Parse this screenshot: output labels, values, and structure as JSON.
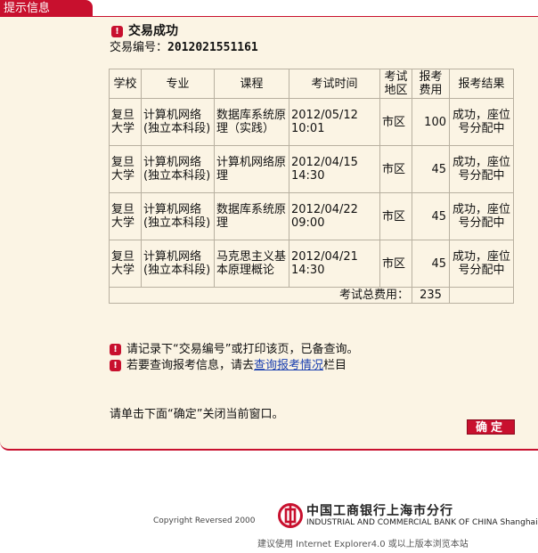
{
  "tab": {
    "label": "提示信息"
  },
  "header": {
    "status": "交易成功",
    "txn_label": "交易编号：",
    "txn_no": "2012021551161"
  },
  "table": {
    "headers": [
      "学校",
      "专业",
      "课程",
      "考试时间",
      "考试地区",
      "报考费用",
      "报考结果"
    ],
    "rows": [
      {
        "school": "复旦大学",
        "major": "计算机网络(独立本科段)",
        "course": "数据库系统原理（实践）",
        "time": "2012/05/12 10:01",
        "area": "市区",
        "fee": "100",
        "result": "成功，座位号分配中"
      },
      {
        "school": "复旦大学",
        "major": "计算机网络(独立本科段)",
        "course": "计算机网络原理",
        "time": "2012/04/15 14:30",
        "area": "市区",
        "fee": "45",
        "result": "成功，座位号分配中"
      },
      {
        "school": "复旦大学",
        "major": "计算机网络(独立本科段)",
        "course": "数据库系统原理",
        "time": "2012/04/22 09:00",
        "area": "市区",
        "fee": "45",
        "result": "成功，座位号分配中"
      },
      {
        "school": "复旦大学",
        "major": "计算机网络(独立本科段)",
        "course": "马克思主义基本原理概论",
        "time": "2012/04/21 14:30",
        "area": "市区",
        "fee": "45",
        "result": "成功，座位号分配中"
      }
    ],
    "total_label": "考试总费用：",
    "total_value": "235"
  },
  "notes": {
    "line1": "请记录下“交易编号”或打印该页，已备查询。",
    "line2_pre": "若要查询报考信息，请去",
    "line2_link": "查询报考情况",
    "line2_post": "栏目"
  },
  "close_note": "请单击下面“确定”关闭当前窗口。",
  "ok_button": "确定",
  "footer": {
    "copyright": "Copyright Reversed 2000",
    "bank_cn": "中国工商银行上海市分行",
    "bank_en": "INDUSTRIAL AND COMMERCIAL BANK OF CHINA Shanghai",
    "browser_note": "建议使用 Internet Explorer4.0 或以上版本浏览本站"
  },
  "colors": {
    "brand_red": "#c8102e",
    "panel_bg": "#fbf4e4",
    "link_blue": "#1a3fb0"
  },
  "icons": {
    "bullet": "exclamation-icon",
    "logo": "icbc-logo-icon"
  }
}
